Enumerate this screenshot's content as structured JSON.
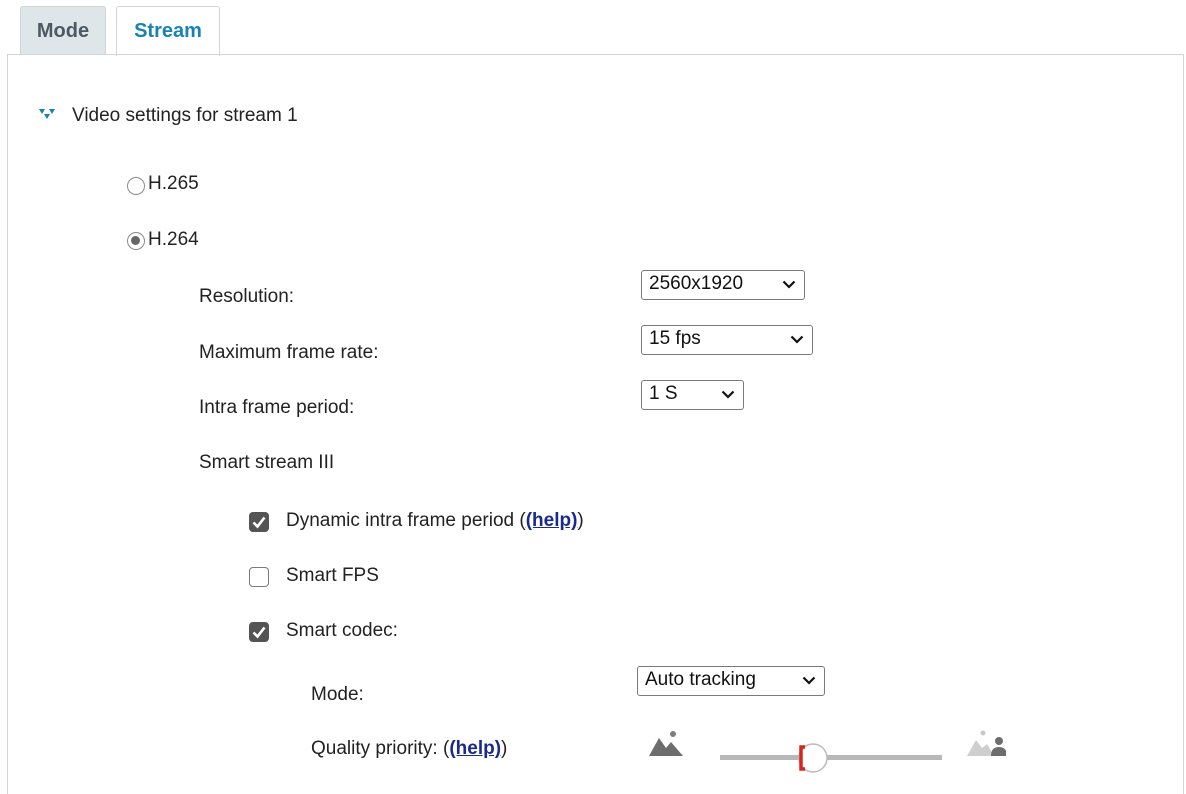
{
  "tabs": [
    {
      "label": "Mode",
      "active": false
    },
    {
      "label": "Stream",
      "active": true
    }
  ],
  "section": {
    "title": "Video settings for stream 1",
    "icon": "triangle-expand-icon"
  },
  "codec": {
    "h265_label": "H.265",
    "h264_label": "H.264",
    "selected": "H.264"
  },
  "resolution": {
    "label": "Resolution:",
    "value": "2560x1920"
  },
  "frame_rate": {
    "label": "Maximum frame rate:",
    "value": "15 fps"
  },
  "intra_period": {
    "label": "Intra frame period:",
    "value": "1 S"
  },
  "smart_stream": {
    "title": "Smart stream III",
    "dynamic_intra": {
      "label": "Dynamic intra frame period (",
      "help": "(help)",
      "suffix": ")",
      "checked": true
    },
    "smart_fps": {
      "label": "Smart FPS",
      "checked": false
    },
    "smart_codec": {
      "label": "Smart codec:",
      "checked": true
    },
    "mode": {
      "label": "Mode:",
      "value": "Auto tracking"
    },
    "quality": {
      "label": "Quality priority: (",
      "help": "(help)",
      "suffix": ")",
      "slider_fraction": 0.42
    }
  },
  "colors": {
    "accent": "#1a82b3",
    "link": "#1a2a8c",
    "slider_thumb_mark": "#d9261c"
  }
}
